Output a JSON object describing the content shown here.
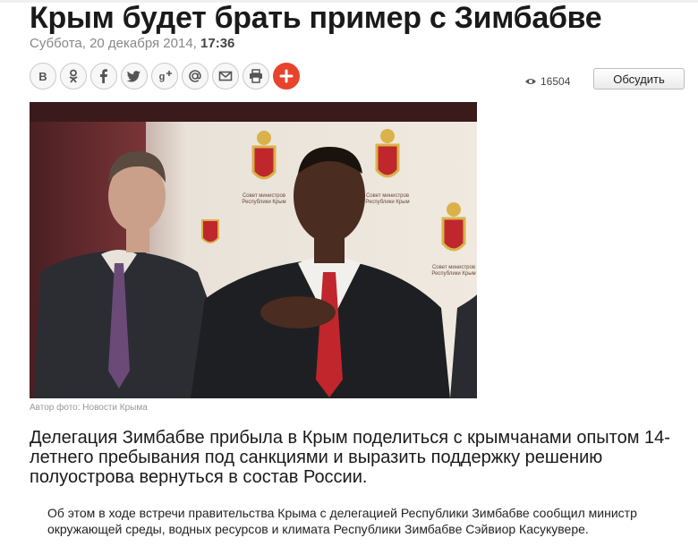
{
  "article": {
    "title": "Крым будет брать пример с Зимбабве",
    "date": "Суббота, 20 декабря 2014,",
    "time": "17:36",
    "views": "16504",
    "discuss_label": "Обсудить",
    "photo_caption": "Автор фото: Новости Крыма",
    "lead": "Делегация Зимбабве прибыла в Крым поделиться с крымчанами опытом 14-летнего пребывания под санкциями и выразить поддержку решению полуострова вернуться в состав России.",
    "body": "Об этом в ходе встречи правительства Крыма с делегацией Республики Зимбабве сообщил министр окружающей среды, водных ресурсов и климата Республики Зимбабве Сэйвиор Касукувере."
  },
  "share": {
    "buttons": [
      "vk-icon",
      "odnoklassniki-icon",
      "facebook-icon",
      "twitter-icon",
      "google-plus-icon",
      "at-sign-icon",
      "mail-icon",
      "print-icon",
      "plus-icon"
    ],
    "accent_color": "#e8432d"
  },
  "photo": {
    "backdrop_text_1": "Совет министров\nРеспублики Крым",
    "backdrop_text_2": "Совет министров\nРеспублики Крым",
    "backdrop_text_3": "Совет министров\nРеспублики Крым"
  }
}
